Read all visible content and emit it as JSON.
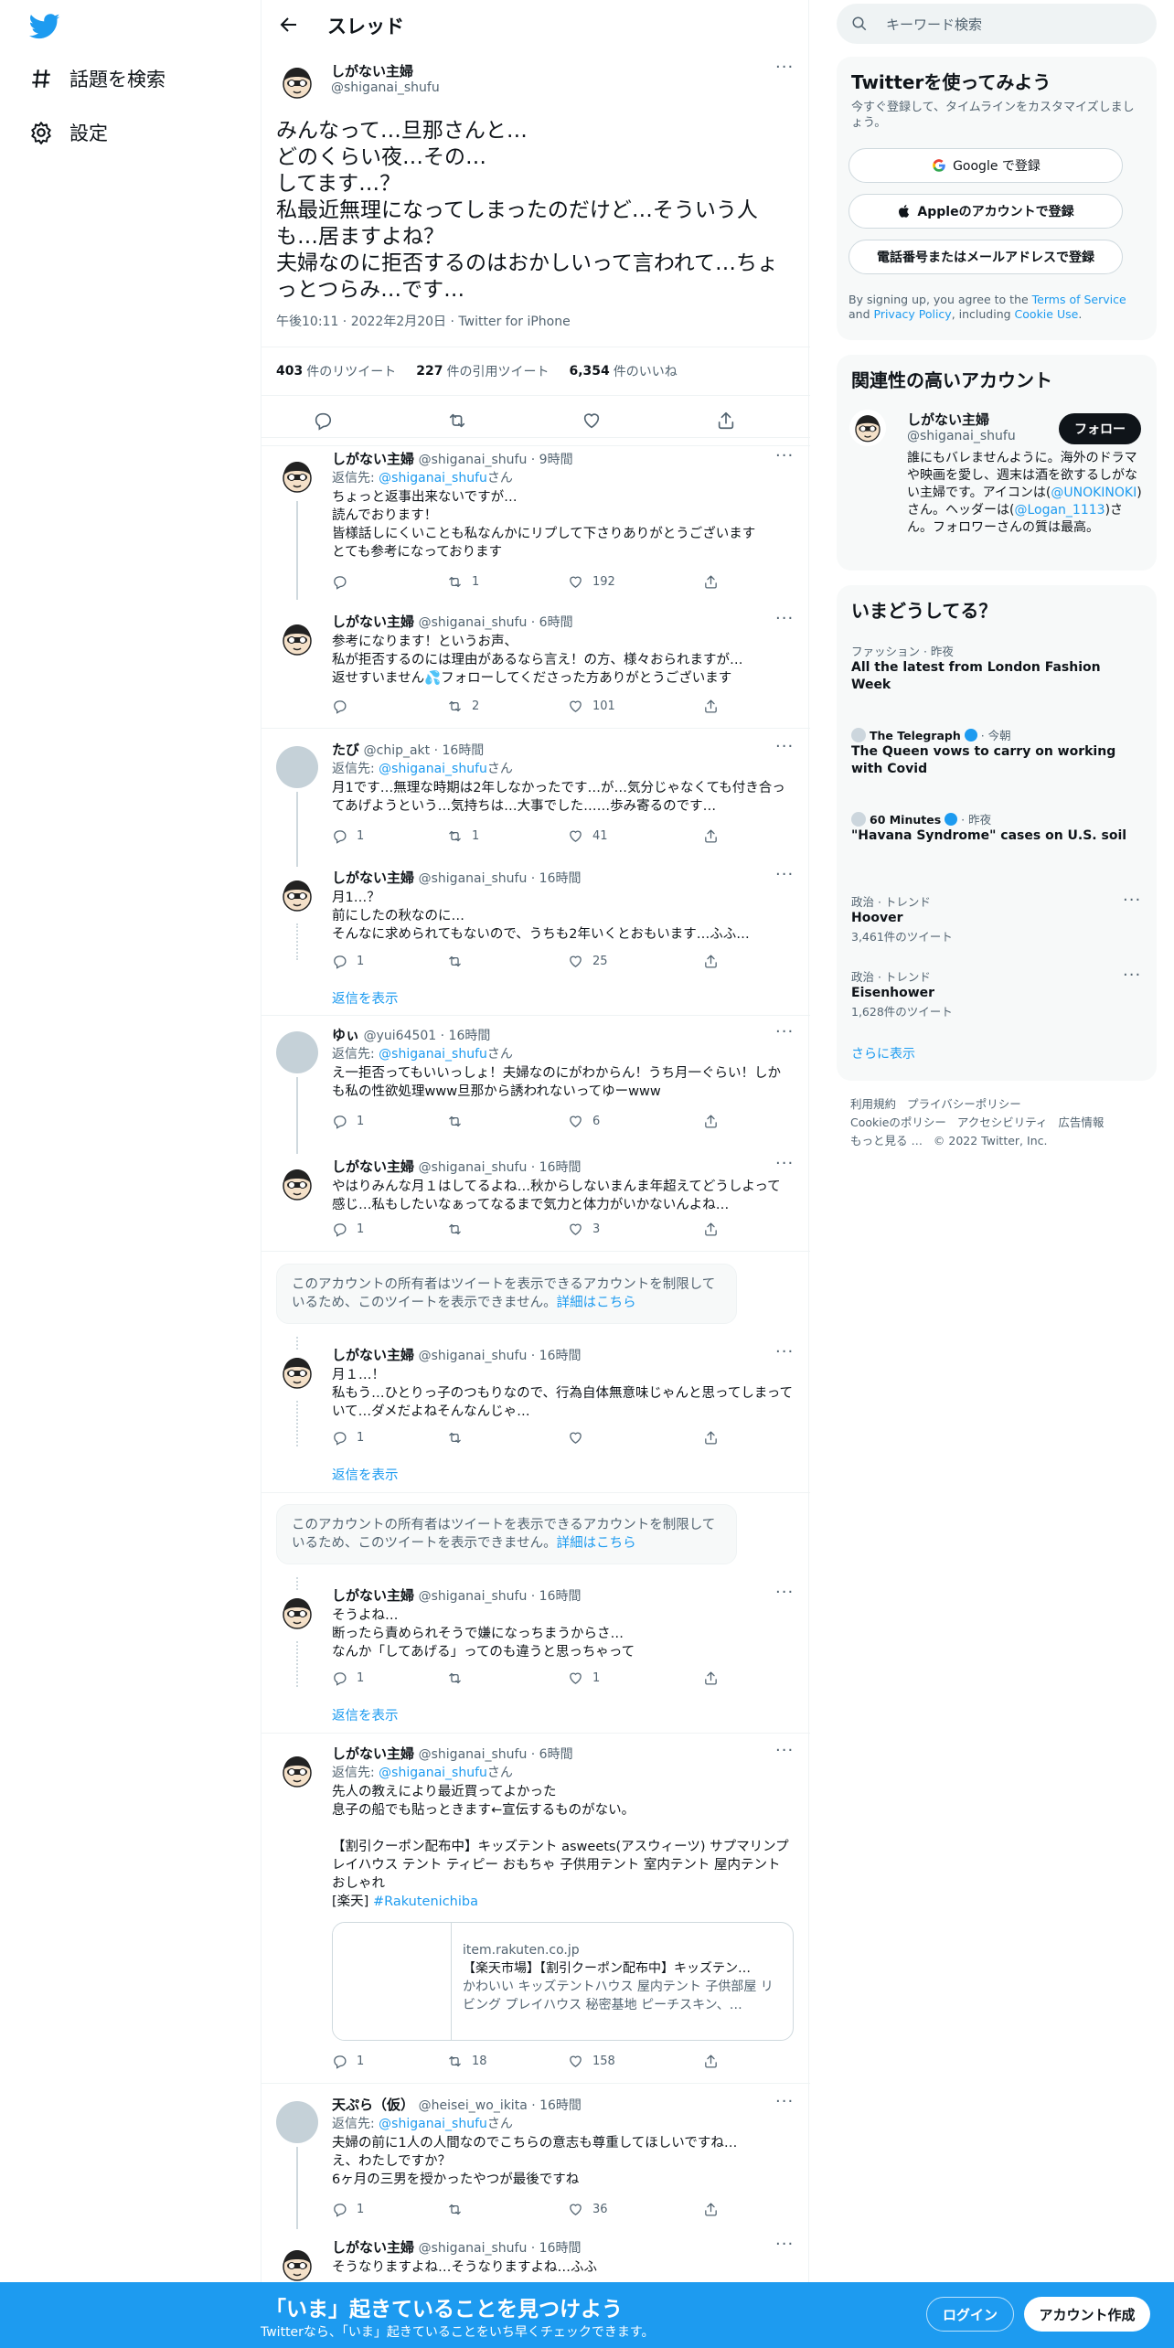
{
  "nav": {
    "explore": "話題を検索",
    "settings": "設定"
  },
  "header": {
    "title": "スレッド"
  },
  "main_tweet": {
    "name": "しがない主婦",
    "handle": "@shiganai_shufu",
    "text": "みんなって…旦那さんと…\nどのくらい夜…その…\nしてます…？\n私最近無理になってしまったのだけど…そういう人も…居ますよね？\n夫婦なのに拒否するのはおかしいって言われて…ちょっとつらみ…です…",
    "meta": "午後10:11 · 2022年2月20日 · Twitter for iPhone",
    "retweets": "403",
    "retweets_label": "件のリツイート",
    "quotes": "227",
    "quotes_label": "件の引用ツイート",
    "likes": "6,354",
    "likes_label": "件のいいね"
  },
  "replies": [
    {
      "name": "しがない主婦",
      "handle": "@shiganai_shufu · 9時間",
      "reply_prefix": "返信先: ",
      "reply_to": "@shiganai_shufu",
      "reply_suffix": "さん",
      "text": "ちょっと返事出来ないですが…\n読んでおります！\n皆様話しにくいことも私なんかにリプして下さりありがとうございます\nとても参考になっております",
      "rt": "1",
      "like": "192"
    },
    {
      "name": "しがない主婦",
      "handle": "@shiganai_shufu · 6時間",
      "text": "参考になります！というお声、\n私が拒否するのには理由があるなら言え！の方、様々おられますが…\n返せすいません💦フォローしてくださった方ありがとうございます",
      "rt": "2",
      "like": "101"
    },
    {
      "name": "たび",
      "handle": "@chip_akt · 16時間",
      "reply_prefix": "返信先: ",
      "reply_to": "@shiganai_shufu",
      "reply_suffix": "さん",
      "text": "月1です…無理な時期は2年しなかったです…が…気分じゃなくても付き合ってあげようという…気持ちは…大事でした……歩み寄るのです…",
      "reply": "1",
      "rt": "1",
      "like": "41"
    },
    {
      "name": "しがない主婦",
      "handle": "@shiganai_shufu · 16時間",
      "text": "月1…？\n前にしたの秋なのに…\nそんなに求められてもないので、うちも2年いくとおもいます…ふふ…",
      "reply": "1",
      "like": "25"
    },
    {
      "name": "ゆぃ",
      "handle": "@yui64501 · 16時間",
      "reply_prefix": "返信先: ",
      "reply_to": "@shiganai_shufu",
      "reply_suffix": "さん",
      "text": "え一拒否ってもいいっしょ！夫婦なのにがわからん！うち月一ぐらい！しかも私の性欲処理www旦那から誘われないってゆーwww",
      "reply": "1",
      "like": "6"
    },
    {
      "name": "しがない主婦",
      "handle": "@shiganai_shufu · 16時間",
      "text": "やはりみんな月１はしてるよね…秋からしないまんま年超えてどうしよって感じ…私もしたいなぁってなるまで気力と体力がいかないんよね…",
      "reply": "1",
      "like": "3"
    },
    {
      "name": "しがない主婦",
      "handle": "@shiganai_shufu · 16時間",
      "text": "月１…！\n私もう…ひとりっ子のつもりなので、行為自体無意味じゃんと思ってしまっていて…ダメだよねそんなんじゃ…",
      "reply": "1"
    },
    {
      "name": "しがない主婦",
      "handle": "@shiganai_shufu · 16時間",
      "text": "そうよね…\n断ったら責められそうで嫌になっちまうからさ…\nなんか「してあげる」ってのも違うと思っちゃって",
      "reply": "1",
      "like": "1"
    },
    {
      "name": "しがない主婦",
      "handle": "@shiganai_shufu · 6時間",
      "reply_prefix": "返信先: ",
      "reply_to": "@shiganai_shufu",
      "reply_suffix": "さん",
      "text": "先人の教えにより最近買ってよかった\n息子の船でも貼っときます←宣伝するものがない。\n\n【割引クーポン配布中】キッズテント asweets(アスウィーツ) サプマリンプレイハウス テント ティピー おもちゃ 子供用テント 室内テント 屋内テント おしゃれ\n[楽天] ",
      "hashtag": "#Rakutenichiba",
      "reply": "1",
      "rt": "18",
      "like": "158"
    },
    {
      "name": "天ぷら（仮）",
      "handle": "@heisei_wo_ikita · 16時間",
      "reply_prefix": "返信先: ",
      "reply_to": "@shiganai_shufu",
      "reply_suffix": "さん",
      "text": "夫婦の前に1人の人間なのでこちらの意志も尊重してほしいですね…\nえ、わたしですか？\n6ヶ月の三男を授かったやつが最後ですね",
      "reply": "1",
      "like": "36"
    },
    {
      "name": "しがない主婦",
      "handle": "@shiganai_shufu · 16時間",
      "text": "そうなりますよね…そうなりますよね…ふふ"
    }
  ],
  "show_replies": "返信を表示",
  "restricted": {
    "text": "このアカウントの所有者はツイートを表示できるアカウントを制限しているため、このツイートを表示できません。",
    "link": "詳細はこちら"
  },
  "card": {
    "domain": "item.rakuten.co.jp",
    "title": "【楽天市場】【割引クーポン配布中】キッズテン…",
    "desc": "かわいい キッズテントハウス 屋内テント 子供部屋 リビング プレイハウス 秘密基地 ピーチスキン、…"
  },
  "sidebar": {
    "search_placeholder": "キーワード検索",
    "signup_title": "Twitterを使ってみよう",
    "signup_sub": "今すぐ登録して、タイムラインをカスタマイズしましょう。",
    "google": "Google で登録",
    "apple": "Appleのアカウントで登録",
    "phone": "電話番号またはメールアドレスで登録",
    "terms_1": "By signing up, you agree to the ",
    "terms_tos": "Terms of Service",
    "terms_2": " and ",
    "terms_pp": "Privacy Policy",
    "terms_3": ", including ",
    "terms_cookie": "Cookie Use",
    "terms_4": ".",
    "relevant_title": "関連性の高いアカウント",
    "rel_name": "しがない主婦",
    "rel_handle": "@shiganai_shufu",
    "follow": "フォロー",
    "bio_1": "誰にもバレませんように。海外のドラマや映画を愛し、週末は酒を欲するしがない主婦です。アイコンは(",
    "bio_link1": "@UNOKINOKI",
    "bio_2": ")さん。ヘッダーは(",
    "bio_link2": "@Logan_1113",
    "bio_3": ")さん。フォロワーさんの質は最高。",
    "trends_title": "いまどうしてる？",
    "trends": [
      {
        "cat": "ファッション · 昨夜",
        "title": "All the latest from London Fashion Week"
      },
      {
        "source": "The Telegraph",
        "cat": " · 今朝",
        "title": "The Queen vows to carry on working with Covid"
      },
      {
        "source": "60 Minutes",
        "cat": " · 昨夜",
        "title": "\"Havana Syndrome\" cases on U.S. soil"
      },
      {
        "cat": "政治 · トレンド",
        "title": "Hoover",
        "count": "3,461件のツイート"
      },
      {
        "cat": "政治 · トレンド",
        "title": "Eisenhower",
        "count": "1,628件のツイート"
      }
    ],
    "show_more": "さらに表示",
    "footer": [
      "利用規約",
      "プライバシーポリシー",
      "Cookieのポリシー",
      "アクセシビリティ",
      "広告情報",
      "もっと見る …",
      "© 2022 Twitter, Inc."
    ]
  },
  "bottom": {
    "headline": "「いま」起きていることを見つけよう",
    "sub": "Twitterなら、「いま」起きていることをいち早くチェックできます。",
    "login": "ログイン",
    "signup": "アカウント作成"
  },
  "colors": {
    "accent": "#1d9bf0",
    "text": "#0f1419",
    "muted": "#536471"
  }
}
